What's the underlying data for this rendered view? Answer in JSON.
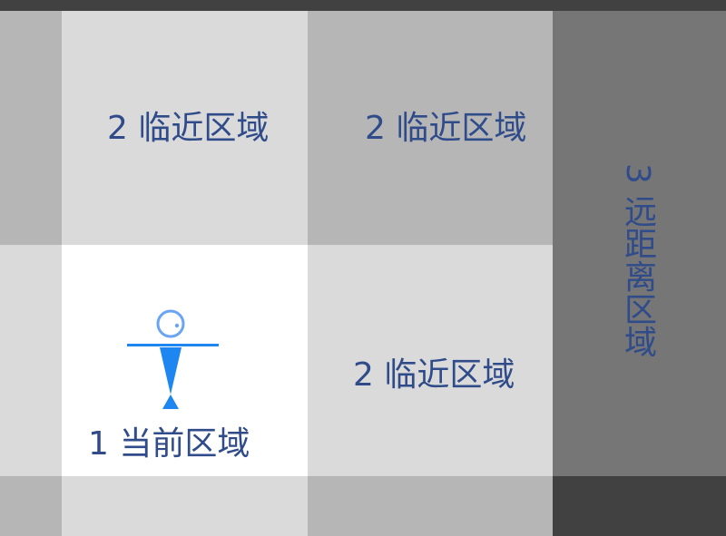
{
  "zones": {
    "current": {
      "label": "1 当前区域"
    },
    "adjacent_top_left": {
      "label": "2 临近区域"
    },
    "adjacent_top_right": {
      "label": "2 临近区域"
    },
    "adjacent_right": {
      "label": "2 临近区域"
    },
    "far": {
      "label": "3 远距离区域"
    }
  },
  "colors": {
    "background": "#414141",
    "mid_gray": "#b6b6b6",
    "light_gray": "#dadada",
    "current_white": "#ffffff",
    "far_gray": "#767676",
    "label_blue": "#2f4b8a",
    "figure_blue": "#1e86f0"
  },
  "icons": {
    "player": "person-figure-icon"
  }
}
